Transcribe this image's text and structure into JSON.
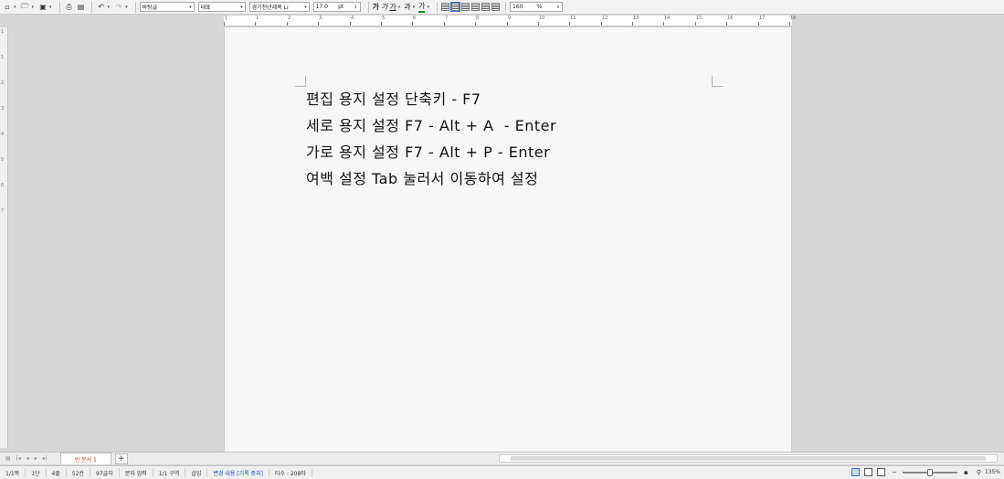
{
  "toolbar": {
    "style_value": "바탕글",
    "lang_value": "대표",
    "font_value": "경기천년제목 Li",
    "size_value": "17.0",
    "size_unit": "pt",
    "bold_glyph": "가",
    "italic_glyph": "가",
    "underline_glyph": "가",
    "strike_glyph": "과",
    "color_glyph": "가",
    "zoom_value": "160",
    "zoom_unit": "%"
  },
  "ruler": {
    "marks": [
      "1",
      "1",
      "2",
      "3",
      "4",
      "5",
      "6",
      "7",
      "8",
      "9",
      "10",
      "11",
      "12",
      "13",
      "14",
      "15",
      "16",
      "17",
      "18"
    ]
  },
  "document": {
    "lines": [
      "편집 용지 설정 단축키 - F7",
      "세로 용지 설정 F7 - Alt + A  - Enter",
      "가로 용지 설정 F7 - Alt + P - Enter",
      "여백 설정 Tab 눌러서 이동하여 설정"
    ]
  },
  "tabs": {
    "active_label": "빈 문서 1",
    "add_label": "+"
  },
  "status": {
    "page": "1/1쪽",
    "column": "1단",
    "line": "4줄",
    "col": "52칸",
    "chars": "97글자",
    "input_mode": "문자 입력",
    "section": "1/1 구역",
    "insert_mode": "삽입",
    "track_changes": "변경 내용 [기록 중지]",
    "typing_count": "타수 : 208타",
    "zoom": "135%"
  }
}
